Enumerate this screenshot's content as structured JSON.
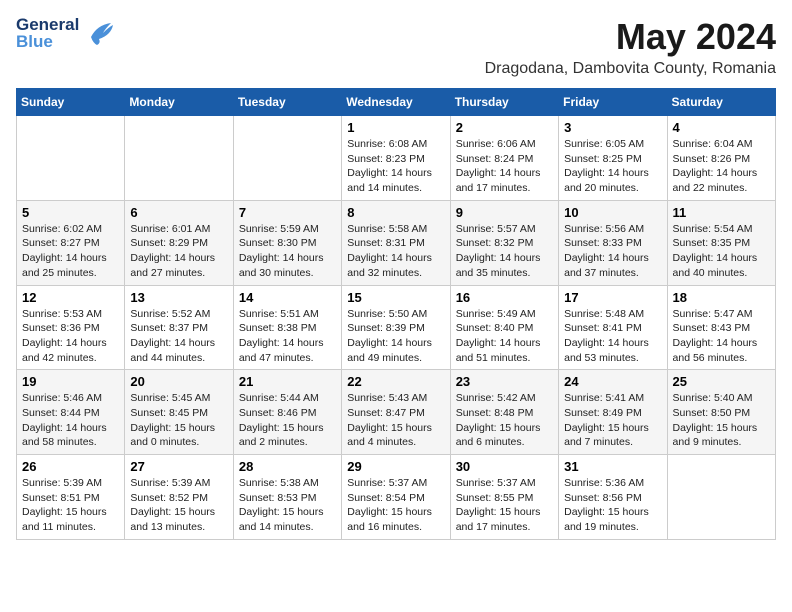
{
  "logo": {
    "line1": "General",
    "line2": "Blue"
  },
  "title": "May 2024",
  "location": "Dragodana, Dambovita County, Romania",
  "days_header": [
    "Sunday",
    "Monday",
    "Tuesday",
    "Wednesday",
    "Thursday",
    "Friday",
    "Saturday"
  ],
  "weeks": [
    [
      {
        "day": "",
        "info": ""
      },
      {
        "day": "",
        "info": ""
      },
      {
        "day": "",
        "info": ""
      },
      {
        "day": "1",
        "info": "Sunrise: 6:08 AM\nSunset: 8:23 PM\nDaylight: 14 hours\nand 14 minutes."
      },
      {
        "day": "2",
        "info": "Sunrise: 6:06 AM\nSunset: 8:24 PM\nDaylight: 14 hours\nand 17 minutes."
      },
      {
        "day": "3",
        "info": "Sunrise: 6:05 AM\nSunset: 8:25 PM\nDaylight: 14 hours\nand 20 minutes."
      },
      {
        "day": "4",
        "info": "Sunrise: 6:04 AM\nSunset: 8:26 PM\nDaylight: 14 hours\nand 22 minutes."
      }
    ],
    [
      {
        "day": "5",
        "info": "Sunrise: 6:02 AM\nSunset: 8:27 PM\nDaylight: 14 hours\nand 25 minutes."
      },
      {
        "day": "6",
        "info": "Sunrise: 6:01 AM\nSunset: 8:29 PM\nDaylight: 14 hours\nand 27 minutes."
      },
      {
        "day": "7",
        "info": "Sunrise: 5:59 AM\nSunset: 8:30 PM\nDaylight: 14 hours\nand 30 minutes."
      },
      {
        "day": "8",
        "info": "Sunrise: 5:58 AM\nSunset: 8:31 PM\nDaylight: 14 hours\nand 32 minutes."
      },
      {
        "day": "9",
        "info": "Sunrise: 5:57 AM\nSunset: 8:32 PM\nDaylight: 14 hours\nand 35 minutes."
      },
      {
        "day": "10",
        "info": "Sunrise: 5:56 AM\nSunset: 8:33 PM\nDaylight: 14 hours\nand 37 minutes."
      },
      {
        "day": "11",
        "info": "Sunrise: 5:54 AM\nSunset: 8:35 PM\nDaylight: 14 hours\nand 40 minutes."
      }
    ],
    [
      {
        "day": "12",
        "info": "Sunrise: 5:53 AM\nSunset: 8:36 PM\nDaylight: 14 hours\nand 42 minutes."
      },
      {
        "day": "13",
        "info": "Sunrise: 5:52 AM\nSunset: 8:37 PM\nDaylight: 14 hours\nand 44 minutes."
      },
      {
        "day": "14",
        "info": "Sunrise: 5:51 AM\nSunset: 8:38 PM\nDaylight: 14 hours\nand 47 minutes."
      },
      {
        "day": "15",
        "info": "Sunrise: 5:50 AM\nSunset: 8:39 PM\nDaylight: 14 hours\nand 49 minutes."
      },
      {
        "day": "16",
        "info": "Sunrise: 5:49 AM\nSunset: 8:40 PM\nDaylight: 14 hours\nand 51 minutes."
      },
      {
        "day": "17",
        "info": "Sunrise: 5:48 AM\nSunset: 8:41 PM\nDaylight: 14 hours\nand 53 minutes."
      },
      {
        "day": "18",
        "info": "Sunrise: 5:47 AM\nSunset: 8:43 PM\nDaylight: 14 hours\nand 56 minutes."
      }
    ],
    [
      {
        "day": "19",
        "info": "Sunrise: 5:46 AM\nSunset: 8:44 PM\nDaylight: 14 hours\nand 58 minutes."
      },
      {
        "day": "20",
        "info": "Sunrise: 5:45 AM\nSunset: 8:45 PM\nDaylight: 15 hours\nand 0 minutes."
      },
      {
        "day": "21",
        "info": "Sunrise: 5:44 AM\nSunset: 8:46 PM\nDaylight: 15 hours\nand 2 minutes."
      },
      {
        "day": "22",
        "info": "Sunrise: 5:43 AM\nSunset: 8:47 PM\nDaylight: 15 hours\nand 4 minutes."
      },
      {
        "day": "23",
        "info": "Sunrise: 5:42 AM\nSunset: 8:48 PM\nDaylight: 15 hours\nand 6 minutes."
      },
      {
        "day": "24",
        "info": "Sunrise: 5:41 AM\nSunset: 8:49 PM\nDaylight: 15 hours\nand 7 minutes."
      },
      {
        "day": "25",
        "info": "Sunrise: 5:40 AM\nSunset: 8:50 PM\nDaylight: 15 hours\nand 9 minutes."
      }
    ],
    [
      {
        "day": "26",
        "info": "Sunrise: 5:39 AM\nSunset: 8:51 PM\nDaylight: 15 hours\nand 11 minutes."
      },
      {
        "day": "27",
        "info": "Sunrise: 5:39 AM\nSunset: 8:52 PM\nDaylight: 15 hours\nand 13 minutes."
      },
      {
        "day": "28",
        "info": "Sunrise: 5:38 AM\nSunset: 8:53 PM\nDaylight: 15 hours\nand 14 minutes."
      },
      {
        "day": "29",
        "info": "Sunrise: 5:37 AM\nSunset: 8:54 PM\nDaylight: 15 hours\nand 16 minutes."
      },
      {
        "day": "30",
        "info": "Sunrise: 5:37 AM\nSunset: 8:55 PM\nDaylight: 15 hours\nand 17 minutes."
      },
      {
        "day": "31",
        "info": "Sunrise: 5:36 AM\nSunset: 8:56 PM\nDaylight: 15 hours\nand 19 minutes."
      },
      {
        "day": "",
        "info": ""
      }
    ]
  ]
}
